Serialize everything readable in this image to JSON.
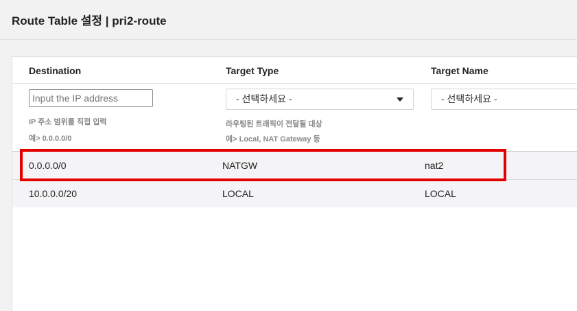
{
  "header": {
    "title": "Route Table 설정 | pri2-route"
  },
  "table": {
    "columns": [
      "Destination",
      "Target Type",
      "Target Name"
    ],
    "filters": {
      "destination": {
        "placeholder": "Input the IP address",
        "hint_line1": "IP 주소 범위를 직접 입력",
        "hint_line2": "예> 0.0.0.0/0"
      },
      "target_type": {
        "selected": "- 선택하세요 -",
        "hint_line1": "라우팅된 트래픽이 전달될 대상",
        "hint_line2": "예> Local, NAT Gateway 등"
      },
      "target_name": {
        "selected": "- 선택하세요 -"
      }
    },
    "rows": [
      {
        "destination": "0.0.0.0/0",
        "target_type": "NATGW",
        "target_name": "nat2",
        "highlighted": true
      },
      {
        "destination": "10.0.0.0/20",
        "target_type": "LOCAL",
        "target_name": "LOCAL",
        "highlighted": false
      }
    ]
  },
  "colors": {
    "highlight": "#e30000",
    "row_bg": "#f4f4f6",
    "page_bg": "#f2f2f2"
  },
  "icons": {
    "dropdown": "caret-down-icon"
  }
}
